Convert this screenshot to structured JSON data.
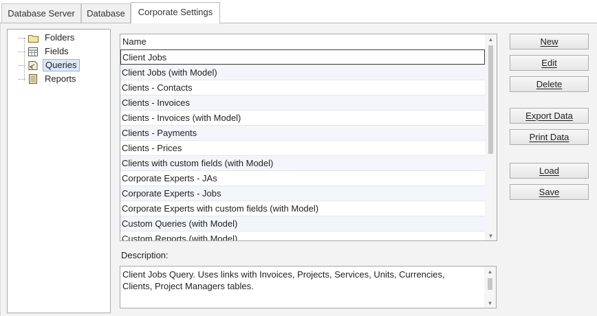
{
  "tabs": [
    {
      "label": "Database Server"
    },
    {
      "label": "Database"
    },
    {
      "label": "Corporate Settings"
    }
  ],
  "tree": {
    "items": [
      {
        "label": "Folders",
        "icon": "folder-icon"
      },
      {
        "label": "Fields",
        "icon": "table-grid-icon"
      },
      {
        "label": "Queries",
        "icon": "query-icon",
        "selected": true
      },
      {
        "label": "Reports",
        "icon": "report-icon"
      }
    ]
  },
  "list": {
    "column_header": "Name",
    "rows": [
      "Client Jobs",
      "Client Jobs (with Model)",
      "Clients - Contacts",
      "Clients - Invoices",
      "Clients - Invoices (with Model)",
      "Clients - Payments",
      "Clients - Prices",
      "Clients with custom fields (with Model)",
      "Corporate Experts - JAs",
      "Corporate Experts - Jobs",
      "Corporate Experts with custom fields (with Model)",
      "Custom Queries (with Model)",
      "Custom Reports (with Model)"
    ]
  },
  "description": {
    "label": "Description:",
    "text": "Client Jobs Query. Uses links with Invoices, Projects, Services, Units, Currencies, Clients, Project Managers tables."
  },
  "buttons": {
    "new": "New",
    "edit": "Edit",
    "delete": "Delete",
    "export": "Export Data",
    "print": "Print Data",
    "load": "Load",
    "save": "Save"
  }
}
